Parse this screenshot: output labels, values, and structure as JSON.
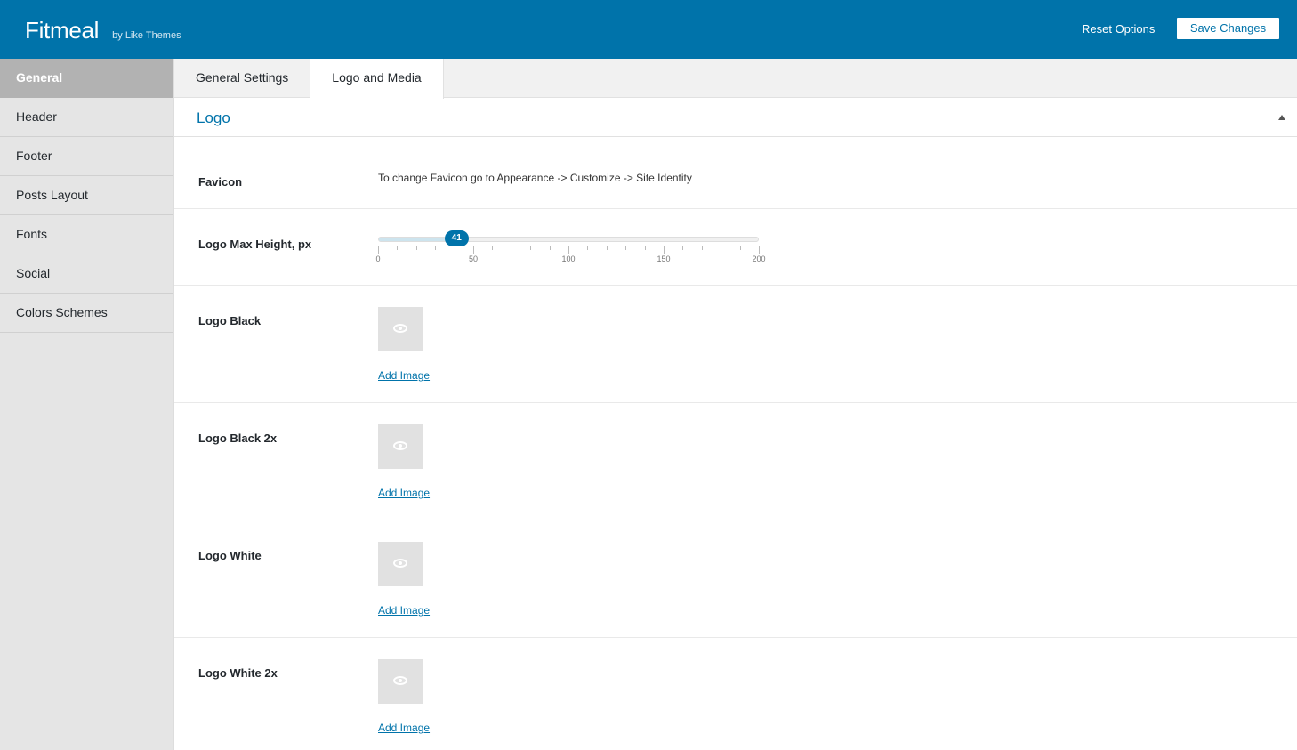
{
  "header": {
    "title": "Fitmeal",
    "byline": "by Like Themes",
    "reset_label": "Reset Options",
    "save_label": "Save Changes"
  },
  "sidebar": {
    "items": [
      {
        "label": "General",
        "active": true
      },
      {
        "label": "Header"
      },
      {
        "label": "Footer"
      },
      {
        "label": "Posts Layout"
      },
      {
        "label": "Fonts"
      },
      {
        "label": "Social"
      },
      {
        "label": "Colors Schemes"
      }
    ]
  },
  "tabs": [
    {
      "label": "General Settings"
    },
    {
      "label": "Logo and Media",
      "active": true
    }
  ],
  "section": {
    "title": "Logo"
  },
  "fields": {
    "favicon": {
      "label": "Favicon",
      "note": "To change Favicon go to Appearance -> Customize -> Site Identity"
    },
    "logo_max_height": {
      "label": "Logo Max Height, px",
      "value": 41,
      "min": 0,
      "max": 200,
      "tick_labels": [
        "0",
        "50",
        "100",
        "150",
        "200"
      ]
    },
    "logo_black": {
      "label": "Logo Black",
      "action": "Add Image"
    },
    "logo_black_2x": {
      "label": "Logo Black 2x",
      "action": "Add Image"
    },
    "logo_white": {
      "label": "Logo White",
      "action": "Add Image"
    },
    "logo_white_2x": {
      "label": "Logo White 2x",
      "action": "Add Image"
    }
  },
  "colors": {
    "brand": "#0073aa",
    "sidebar_active": "#b2b2b2",
    "placeholder": "#e1e1e1"
  },
  "icons": {
    "image_placeholder": "eye-icon",
    "collapse": "triangle-up-icon"
  }
}
